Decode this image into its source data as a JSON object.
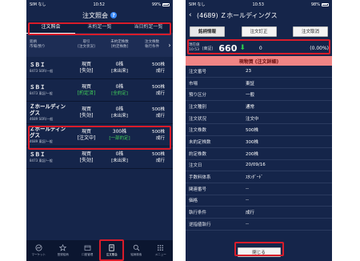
{
  "left": {
    "status": {
      "carrier": "SIM なし",
      "time": "10:52",
      "battery": "99%"
    },
    "title": "注文照会",
    "help_icon": "?",
    "tabs": [
      {
        "label": "注文照会",
        "active": true
      },
      {
        "label": "未約定一覧",
        "active": false
      },
      {
        "label": "当日約定一覧",
        "active": false
      }
    ],
    "columns": [
      {
        "line1": "銘柄",
        "line2": "市場/預り"
      },
      {
        "line1": "取引",
        "line2": "[注文状況]"
      },
      {
        "line1": "未約定株数",
        "line2": "[約定株数]"
      },
      {
        "line1": "注文株数",
        "line2": "執行条件"
      }
    ],
    "orders": [
      {
        "name": "ＳＢＩ",
        "code": "8473 SOR/一般",
        "trade": "現買",
        "status": "[失効]",
        "unfilled": "0株",
        "filled": "[未出来]",
        "qty": "500株",
        "cond": "成行",
        "green": false
      },
      {
        "name": "ＳＢＩ",
        "code": "8473 東証/一般",
        "trade": "現買",
        "status": "[約定済]",
        "unfilled": "0株",
        "filled": "[全約定]",
        "qty": "500株",
        "cond": "成行",
        "green": true
      },
      {
        "name": "Ｚホールディングス",
        "code": "4689 SOR/一般",
        "trade": "現買",
        "status": "[失効]",
        "unfilled": "0株",
        "filled": "[未出来]",
        "qty": "500株",
        "cond": "成行",
        "green": false
      },
      {
        "name": "Ｚホールディングス",
        "code": "4689 東証/一般",
        "trade": "現買",
        "status": "[注文中]",
        "unfilled": "300株",
        "filled": "[一部約定]",
        "qty": "500株",
        "cond": "成行",
        "green": true
      },
      {
        "name": "ＳＢＩ",
        "code": "8473 東証/一般",
        "trade": "現買",
        "status": "[失効]",
        "unfilled": "0株",
        "filled": "[未出来]",
        "qty": "500株",
        "cond": "成行",
        "green": false
      }
    ],
    "nav": [
      {
        "label": "マーケット",
        "icon": "market-icon",
        "active": false
      },
      {
        "label": "登録銘柄",
        "icon": "star-icon",
        "active": false
      },
      {
        "label": "口座管理",
        "icon": "wallet-icon",
        "active": false
      },
      {
        "label": "注文照会",
        "icon": "document-icon",
        "active": true
      },
      {
        "label": "銘柄検索",
        "icon": "search-icon",
        "active": false
      },
      {
        "label": "メニュー",
        "icon": "grid-menu-icon",
        "active": false
      }
    ]
  },
  "right": {
    "status": {
      "carrier": "SIM なし",
      "time": "10:53",
      "battery": "98%"
    },
    "title": "(4689) Ｚホールディングス",
    "buttons": [
      {
        "label": "銘柄情報",
        "active": true
      },
      {
        "label": "注文訂正",
        "active": false
      },
      {
        "label": "注文取消",
        "active": false
      }
    ],
    "price": {
      "time_label": "現在値",
      "time": "10:53",
      "market": "(東証)",
      "value": "660",
      "change": "0",
      "pct": "(0.00%)"
    },
    "section_title": "現物買 (注文詳細)",
    "details": [
      {
        "k": "注文番号",
        "v": "23"
      },
      {
        "k": "市場",
        "v": "東証"
      },
      {
        "k": "預り区分",
        "v": "一般"
      },
      {
        "k": "注文種別",
        "v": "通常"
      },
      {
        "k": "注文状況",
        "v": "注文中"
      },
      {
        "k": "注文株数",
        "v": "500株"
      },
      {
        "k": "未約定株数",
        "v": "300株"
      },
      {
        "k": "約定株数",
        "v": "200株"
      },
      {
        "k": "注文日",
        "v": "20/09/16"
      },
      {
        "k": "手数料体系",
        "v": "ｽﾀﾝﾀﾞｰﾄﾞ"
      },
      {
        "k": "関連番号",
        "v": "--"
      },
      {
        "k": "価格",
        "v": "--"
      },
      {
        "k": "執行条件",
        "v": "成行"
      },
      {
        "k": "逆指値執行",
        "v": "--"
      }
    ],
    "close_label": "閉じる"
  },
  "colors": {
    "bg": "#15254a",
    "highlight_red": "#d81c2a",
    "pink": "#f08585",
    "green": "#42d35a"
  }
}
